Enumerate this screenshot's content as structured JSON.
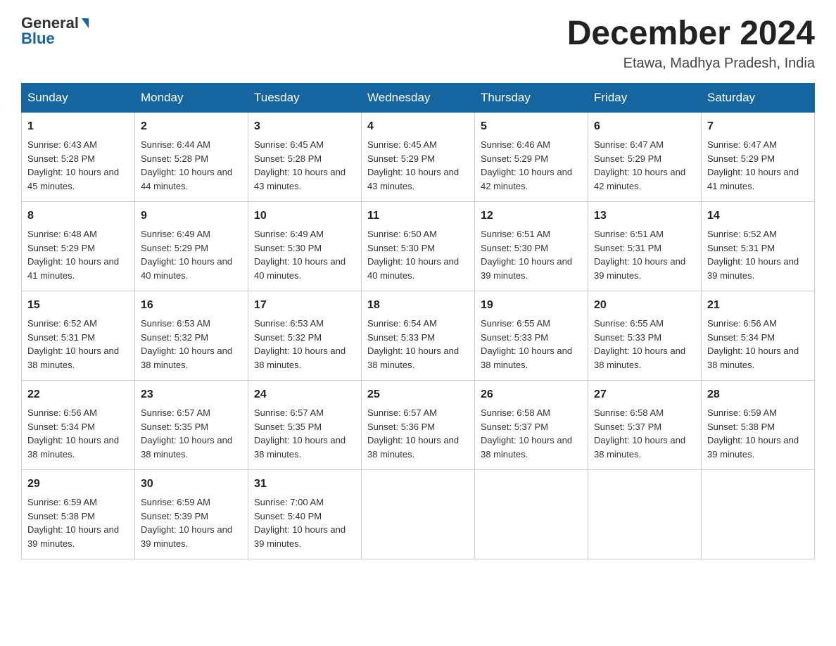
{
  "header": {
    "logo_general": "General",
    "logo_blue": "Blue",
    "month_title": "December 2024",
    "location": "Etawa, Madhya Pradesh, India"
  },
  "days_of_week": [
    "Sunday",
    "Monday",
    "Tuesday",
    "Wednesday",
    "Thursday",
    "Friday",
    "Saturday"
  ],
  "weeks": [
    [
      {
        "day": "1",
        "sunrise": "6:43 AM",
        "sunset": "5:28 PM",
        "daylight": "10 hours and 45 minutes."
      },
      {
        "day": "2",
        "sunrise": "6:44 AM",
        "sunset": "5:28 PM",
        "daylight": "10 hours and 44 minutes."
      },
      {
        "day": "3",
        "sunrise": "6:45 AM",
        "sunset": "5:28 PM",
        "daylight": "10 hours and 43 minutes."
      },
      {
        "day": "4",
        "sunrise": "6:45 AM",
        "sunset": "5:29 PM",
        "daylight": "10 hours and 43 minutes."
      },
      {
        "day": "5",
        "sunrise": "6:46 AM",
        "sunset": "5:29 PM",
        "daylight": "10 hours and 42 minutes."
      },
      {
        "day": "6",
        "sunrise": "6:47 AM",
        "sunset": "5:29 PM",
        "daylight": "10 hours and 42 minutes."
      },
      {
        "day": "7",
        "sunrise": "6:47 AM",
        "sunset": "5:29 PM",
        "daylight": "10 hours and 41 minutes."
      }
    ],
    [
      {
        "day": "8",
        "sunrise": "6:48 AM",
        "sunset": "5:29 PM",
        "daylight": "10 hours and 41 minutes."
      },
      {
        "day": "9",
        "sunrise": "6:49 AM",
        "sunset": "5:29 PM",
        "daylight": "10 hours and 40 minutes."
      },
      {
        "day": "10",
        "sunrise": "6:49 AM",
        "sunset": "5:30 PM",
        "daylight": "10 hours and 40 minutes."
      },
      {
        "day": "11",
        "sunrise": "6:50 AM",
        "sunset": "5:30 PM",
        "daylight": "10 hours and 40 minutes."
      },
      {
        "day": "12",
        "sunrise": "6:51 AM",
        "sunset": "5:30 PM",
        "daylight": "10 hours and 39 minutes."
      },
      {
        "day": "13",
        "sunrise": "6:51 AM",
        "sunset": "5:31 PM",
        "daylight": "10 hours and 39 minutes."
      },
      {
        "day": "14",
        "sunrise": "6:52 AM",
        "sunset": "5:31 PM",
        "daylight": "10 hours and 39 minutes."
      }
    ],
    [
      {
        "day": "15",
        "sunrise": "6:52 AM",
        "sunset": "5:31 PM",
        "daylight": "10 hours and 38 minutes."
      },
      {
        "day": "16",
        "sunrise": "6:53 AM",
        "sunset": "5:32 PM",
        "daylight": "10 hours and 38 minutes."
      },
      {
        "day": "17",
        "sunrise": "6:53 AM",
        "sunset": "5:32 PM",
        "daylight": "10 hours and 38 minutes."
      },
      {
        "day": "18",
        "sunrise": "6:54 AM",
        "sunset": "5:33 PM",
        "daylight": "10 hours and 38 minutes."
      },
      {
        "day": "19",
        "sunrise": "6:55 AM",
        "sunset": "5:33 PM",
        "daylight": "10 hours and 38 minutes."
      },
      {
        "day": "20",
        "sunrise": "6:55 AM",
        "sunset": "5:33 PM",
        "daylight": "10 hours and 38 minutes."
      },
      {
        "day": "21",
        "sunrise": "6:56 AM",
        "sunset": "5:34 PM",
        "daylight": "10 hours and 38 minutes."
      }
    ],
    [
      {
        "day": "22",
        "sunrise": "6:56 AM",
        "sunset": "5:34 PM",
        "daylight": "10 hours and 38 minutes."
      },
      {
        "day": "23",
        "sunrise": "6:57 AM",
        "sunset": "5:35 PM",
        "daylight": "10 hours and 38 minutes."
      },
      {
        "day": "24",
        "sunrise": "6:57 AM",
        "sunset": "5:35 PM",
        "daylight": "10 hours and 38 minutes."
      },
      {
        "day": "25",
        "sunrise": "6:57 AM",
        "sunset": "5:36 PM",
        "daylight": "10 hours and 38 minutes."
      },
      {
        "day": "26",
        "sunrise": "6:58 AM",
        "sunset": "5:37 PM",
        "daylight": "10 hours and 38 minutes."
      },
      {
        "day": "27",
        "sunrise": "6:58 AM",
        "sunset": "5:37 PM",
        "daylight": "10 hours and 38 minutes."
      },
      {
        "day": "28",
        "sunrise": "6:59 AM",
        "sunset": "5:38 PM",
        "daylight": "10 hours and 39 minutes."
      }
    ],
    [
      {
        "day": "29",
        "sunrise": "6:59 AM",
        "sunset": "5:38 PM",
        "daylight": "10 hours and 39 minutes."
      },
      {
        "day": "30",
        "sunrise": "6:59 AM",
        "sunset": "5:39 PM",
        "daylight": "10 hours and 39 minutes."
      },
      {
        "day": "31",
        "sunrise": "7:00 AM",
        "sunset": "5:40 PM",
        "daylight": "10 hours and 39 minutes."
      },
      null,
      null,
      null,
      null
    ]
  ]
}
